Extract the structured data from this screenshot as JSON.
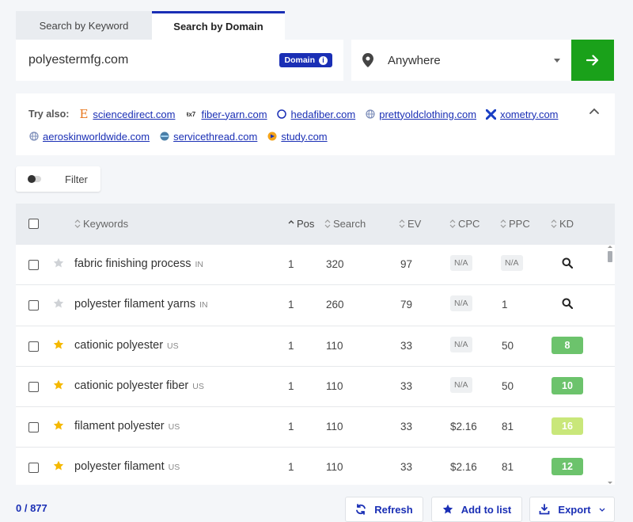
{
  "tabs": {
    "keyword": "Search by Keyword",
    "domain": "Search by Domain"
  },
  "search": {
    "domain_value": "polyestermfg.com",
    "badge": "Domain",
    "location": "Anywhere"
  },
  "try_also": {
    "label": "Try also:",
    "links": [
      {
        "text": "sciencedirect.com",
        "icon": "sciencedirect-favicon"
      },
      {
        "text": "fiber-yarn.com",
        "icon": "fiber-yarn-favicon"
      },
      {
        "text": "hedafiber.com",
        "icon": "globe-icon"
      },
      {
        "text": "prettyoldclothing.com",
        "icon": "globe-icon"
      },
      {
        "text": "xometry.com",
        "icon": "xometry-favicon"
      },
      {
        "text": "aeroskinworldwide.com",
        "icon": "globe-icon"
      },
      {
        "text": "servicethread.com",
        "icon": "servicethread-favicon"
      },
      {
        "text": "study.com",
        "icon": "study-favicon"
      }
    ]
  },
  "filter": {
    "label": "Filter"
  },
  "table": {
    "headers": {
      "keywords": "Keywords",
      "pos": "Pos",
      "search": "Search",
      "ev": "EV",
      "cpc": "CPC",
      "ppc": "PPC",
      "kd": "KD"
    },
    "rows": [
      {
        "keyword": "fabric finishing process",
        "cc": "IN",
        "starred": false,
        "pos": "1",
        "search": "320",
        "ev": "97",
        "cpc": "N/A",
        "ppc": "N/A",
        "kd": ""
      },
      {
        "keyword": "polyester filament yarns",
        "cc": "IN",
        "starred": false,
        "pos": "1",
        "search": "260",
        "ev": "79",
        "cpc": "N/A",
        "ppc": "1",
        "kd": ""
      },
      {
        "keyword": "cationic polyester",
        "cc": "US",
        "starred": true,
        "pos": "1",
        "search": "110",
        "ev": "33",
        "cpc": "N/A",
        "ppc": "50",
        "kd": "8"
      },
      {
        "keyword": "cationic polyester fiber",
        "cc": "US",
        "starred": true,
        "pos": "1",
        "search": "110",
        "ev": "33",
        "cpc": "N/A",
        "ppc": "50",
        "kd": "10"
      },
      {
        "keyword": "filament polyester",
        "cc": "US",
        "starred": true,
        "pos": "1",
        "search": "110",
        "ev": "33",
        "cpc": "$2.16",
        "ppc": "81",
        "kd": "16"
      },
      {
        "keyword": "polyester filament",
        "cc": "US",
        "starred": true,
        "pos": "1",
        "search": "110",
        "ev": "33",
        "cpc": "$2.16",
        "ppc": "81",
        "kd": "12"
      }
    ]
  },
  "footer": {
    "count": "0 / 877",
    "refresh": "Refresh",
    "add_to_list": "Add to list",
    "export": "Export"
  },
  "colors": {
    "accent": "#1a2fb5",
    "go_button": "#1aa11a",
    "kd_green": "#6cc36c",
    "kd_lightgreen": "#c9e77a",
    "star_gold": "#f5b800"
  }
}
